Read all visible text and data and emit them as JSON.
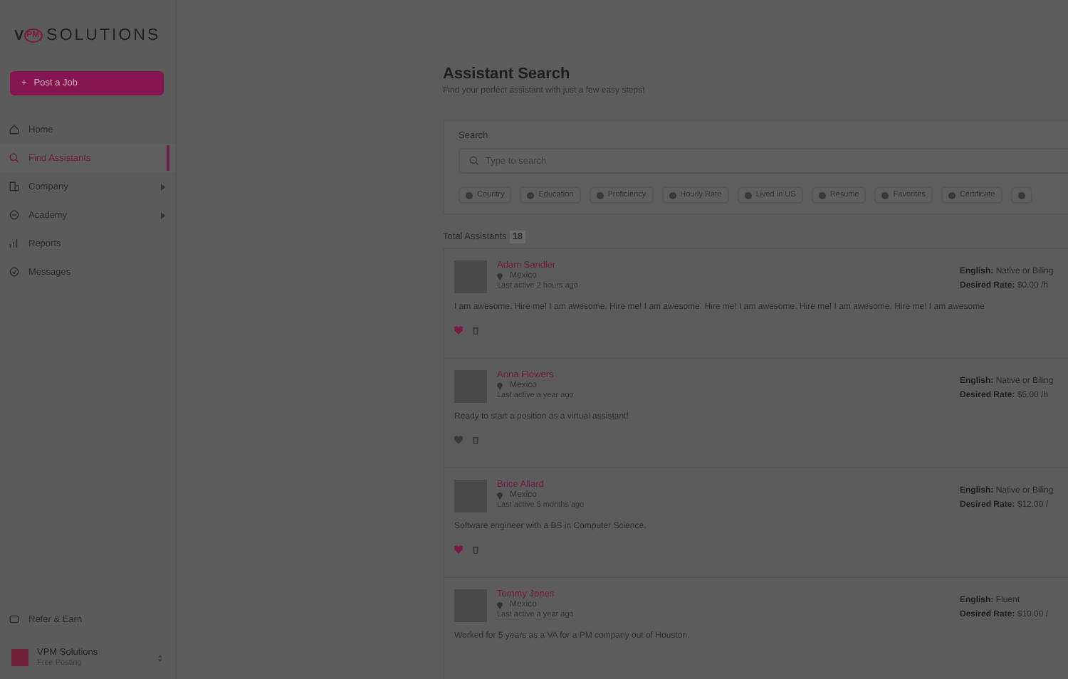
{
  "sidebar": {
    "logo": {
      "letter": "V",
      "mark": "PM",
      "text": "SOLUTIONS"
    },
    "post_button": {
      "icon": "+",
      "label": "Post a Job"
    },
    "items": [
      {
        "label": "Home",
        "selected": false,
        "has_submenu": false
      },
      {
        "label": "Find Assistants",
        "selected": true,
        "has_submenu": false
      },
      {
        "label": "Company",
        "selected": false,
        "has_submenu": true
      },
      {
        "label": "Academy",
        "selected": false,
        "has_submenu": true
      },
      {
        "label": "Reports",
        "selected": false,
        "has_submenu": false
      },
      {
        "label": "Messages",
        "selected": false,
        "has_submenu": false
      }
    ],
    "refer": {
      "label": "Refer & Earn"
    },
    "account": {
      "name": "VPM Solutions",
      "plan": "Free Posting"
    }
  },
  "main": {
    "title": "Assistant Search",
    "subtitle": "Find your perfect assistant with just a few easy steps!",
    "search": {
      "label": "Search",
      "placeholder": "Type to search",
      "filters": [
        "Country",
        "Education",
        "Proficiency",
        "Hourly Rate",
        "Lived in US",
        "Resume",
        "Favorites",
        "Certificate"
      ]
    },
    "total": {
      "label": "Total Assistants",
      "count": "18"
    },
    "assistants": [
      {
        "name": "Adam Sandler",
        "location": "Mexico",
        "last_active": "Last active 2 hours ago",
        "english_label": "English:",
        "english": "Native or Biling",
        "rate_label": "Desired Rate:",
        "rate": "$0.00 /h",
        "bio": "I am awesome. Hire me! I am awesome. Hire me! I am awesome. Hire me! I am awesome. Hire me! I am awesome. Hire me! I am awesome",
        "favorite": true
      },
      {
        "name": "Anna Flowers",
        "location": "Mexico",
        "last_active": "Last active a year ago",
        "english_label": "English:",
        "english": "Native or Biling",
        "rate_label": "Desired Rate:",
        "rate": "$5.00 /h",
        "bio": "Ready to start a position as a virtual assistant!",
        "favorite": false
      },
      {
        "name": "Brice Allard",
        "location": "Mexico",
        "last_active": "Last active 5 months ago",
        "english_label": "English:",
        "english": "Native or Biling",
        "rate_label": "Desired Rate:",
        "rate": "$12.00 /",
        "bio": "Software engineer with a BS in Computer Science.",
        "favorite": true
      },
      {
        "name": "Tommy Jones",
        "location": "Mexico",
        "last_active": "Last active a year ago",
        "english_label": "English:",
        "english": "Fluent",
        "rate_label": "Desired Rate:",
        "rate": "$10.00 /",
        "bio": "Worked for 5 years as a VA for a PM company out of Houston."
      }
    ]
  }
}
